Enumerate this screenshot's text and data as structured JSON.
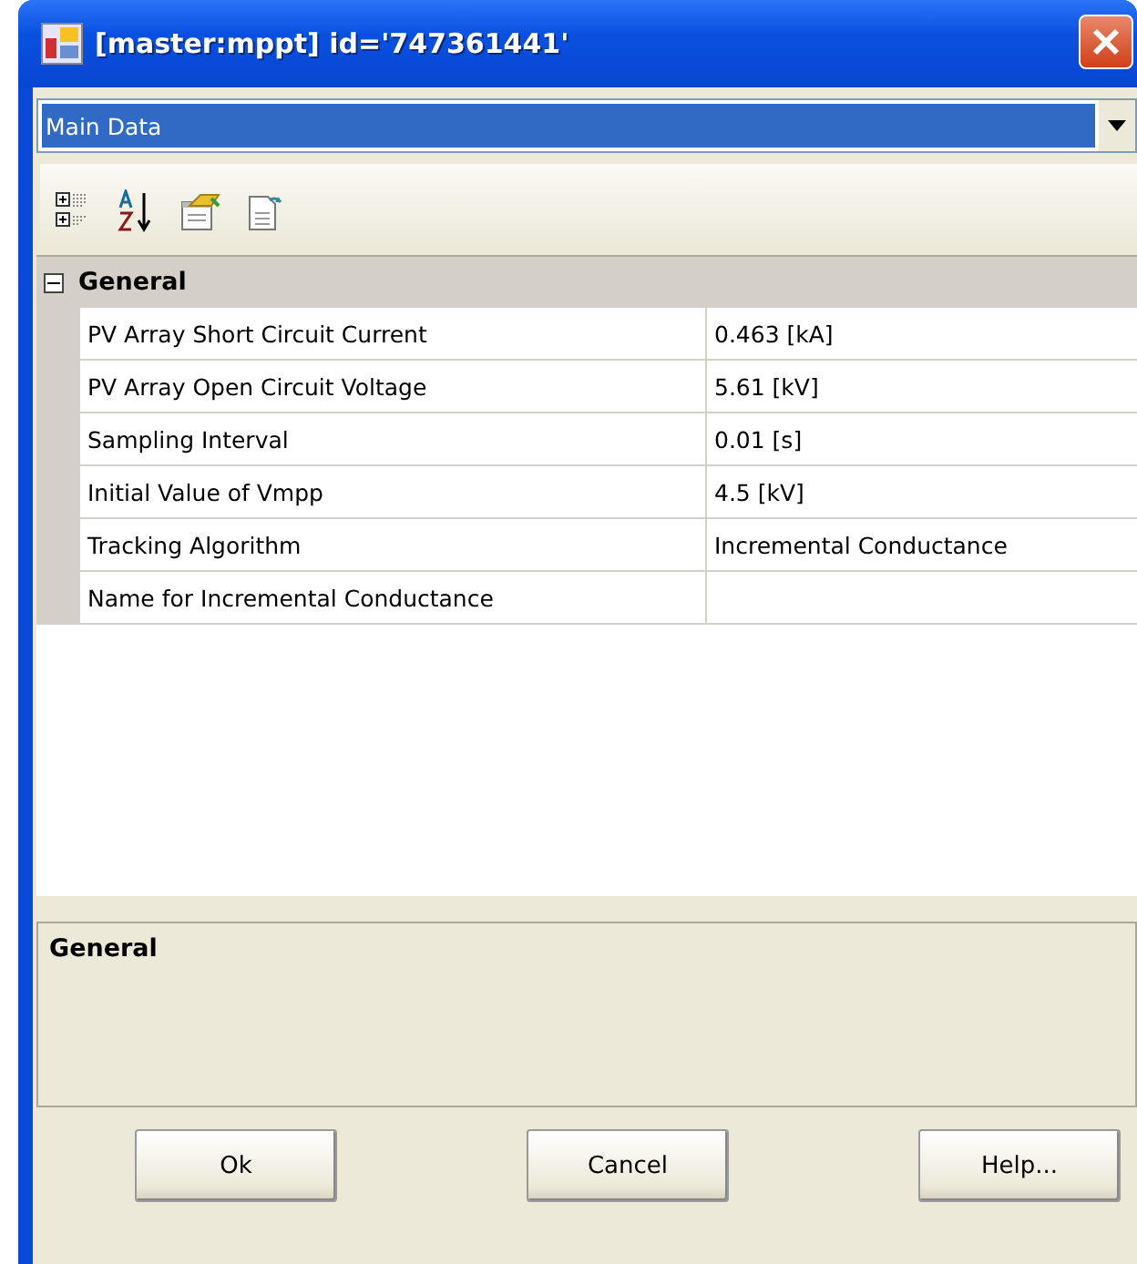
{
  "window": {
    "title": "[master:mppt] id='747361441'"
  },
  "object_selector": {
    "value": "Main Data"
  },
  "toolbar": [
    {
      "kind": "categorized",
      "selected": false
    },
    {
      "kind": "alphabetical",
      "selected": false
    },
    {
      "kind": "properties",
      "selected": false
    },
    {
      "kind": "pages",
      "selected": false
    }
  ],
  "property_grid": {
    "categories": [
      {
        "name": "General",
        "expanded": true,
        "properties": [
          {
            "name": "PV Array Short Circuit Current",
            "value": "0.463 [kA]"
          },
          {
            "name": "PV Array Open Circuit Voltage",
            "value": "5.61 [kV]"
          },
          {
            "name": "Sampling Interval",
            "value": "0.01 [s]"
          },
          {
            "name": "Initial Value of Vmpp",
            "value": "4.5 [kV]"
          },
          {
            "name": "Tracking Algorithm",
            "value": "Incremental Conductance"
          },
          {
            "name": "Name for Incremental Conductance"
          }
        ]
      }
    ]
  },
  "description": {
    "title": "General"
  },
  "buttons": [
    "Ok",
    "Cancel",
    "Help..."
  ]
}
